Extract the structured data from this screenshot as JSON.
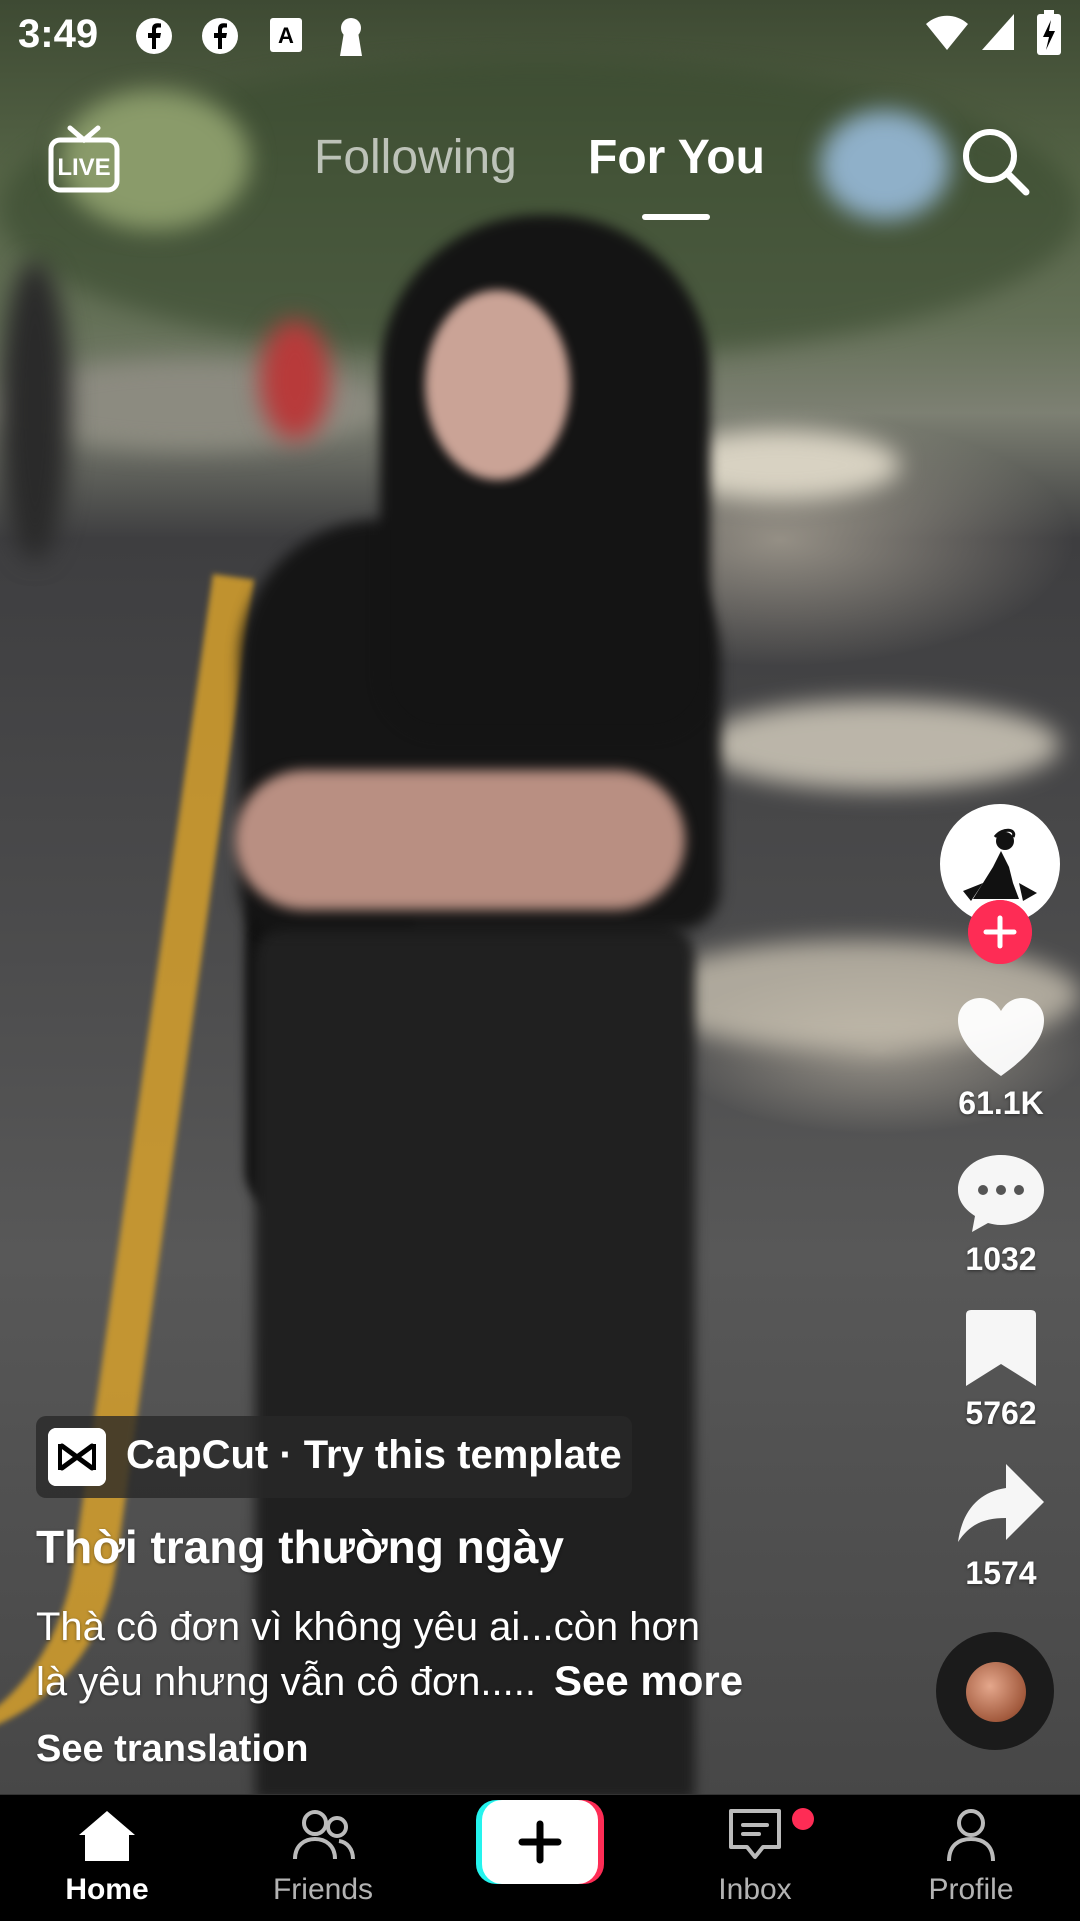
{
  "status_bar": {
    "time": "3:49",
    "notification_icons": [
      "facebook-icon",
      "facebook-icon",
      "app-store-icon",
      "keyhole-icon"
    ],
    "system_icons": [
      "wifi-icon",
      "cellular-icon",
      "battery-icon"
    ]
  },
  "top_nav": {
    "live_icon": "live-tv-icon",
    "live_label": "LIVE",
    "tabs": [
      {
        "label": "Following",
        "active": false
      },
      {
        "label": "For You",
        "active": true
      }
    ],
    "search_icon": "search-icon"
  },
  "actions": {
    "avatar_icon": "creator-avatar",
    "follow_icon": "plus-icon",
    "like_count": "61.1K",
    "comment_count": "1032",
    "bookmark_count": "5762",
    "share_count": "1574",
    "music_icon": "music-disc-icon"
  },
  "caption": {
    "capcut_label": "CapCut · Try this template",
    "title": "Thời trang thường ngày",
    "description_line1": "Thà cô đơn vì không yêu ai...còn hơn",
    "description_line2": "là yêu nhưng vẫn cô đơn.....",
    "see_more": "See more",
    "see_translation": "See translation"
  },
  "bottom_nav": {
    "items": [
      {
        "label": "Home",
        "icon": "home-icon",
        "active": true
      },
      {
        "label": "Friends",
        "icon": "friends-icon",
        "active": false
      },
      {
        "label": "",
        "icon": "create-plus-icon",
        "active": false
      },
      {
        "label": "Inbox",
        "icon": "inbox-icon",
        "active": false,
        "badge": true
      },
      {
        "label": "Profile",
        "icon": "profile-icon",
        "active": false
      }
    ]
  },
  "colors": {
    "accent_red": "#fe2c55",
    "accent_cyan": "#25f4ee",
    "nav_background": "#000000"
  }
}
